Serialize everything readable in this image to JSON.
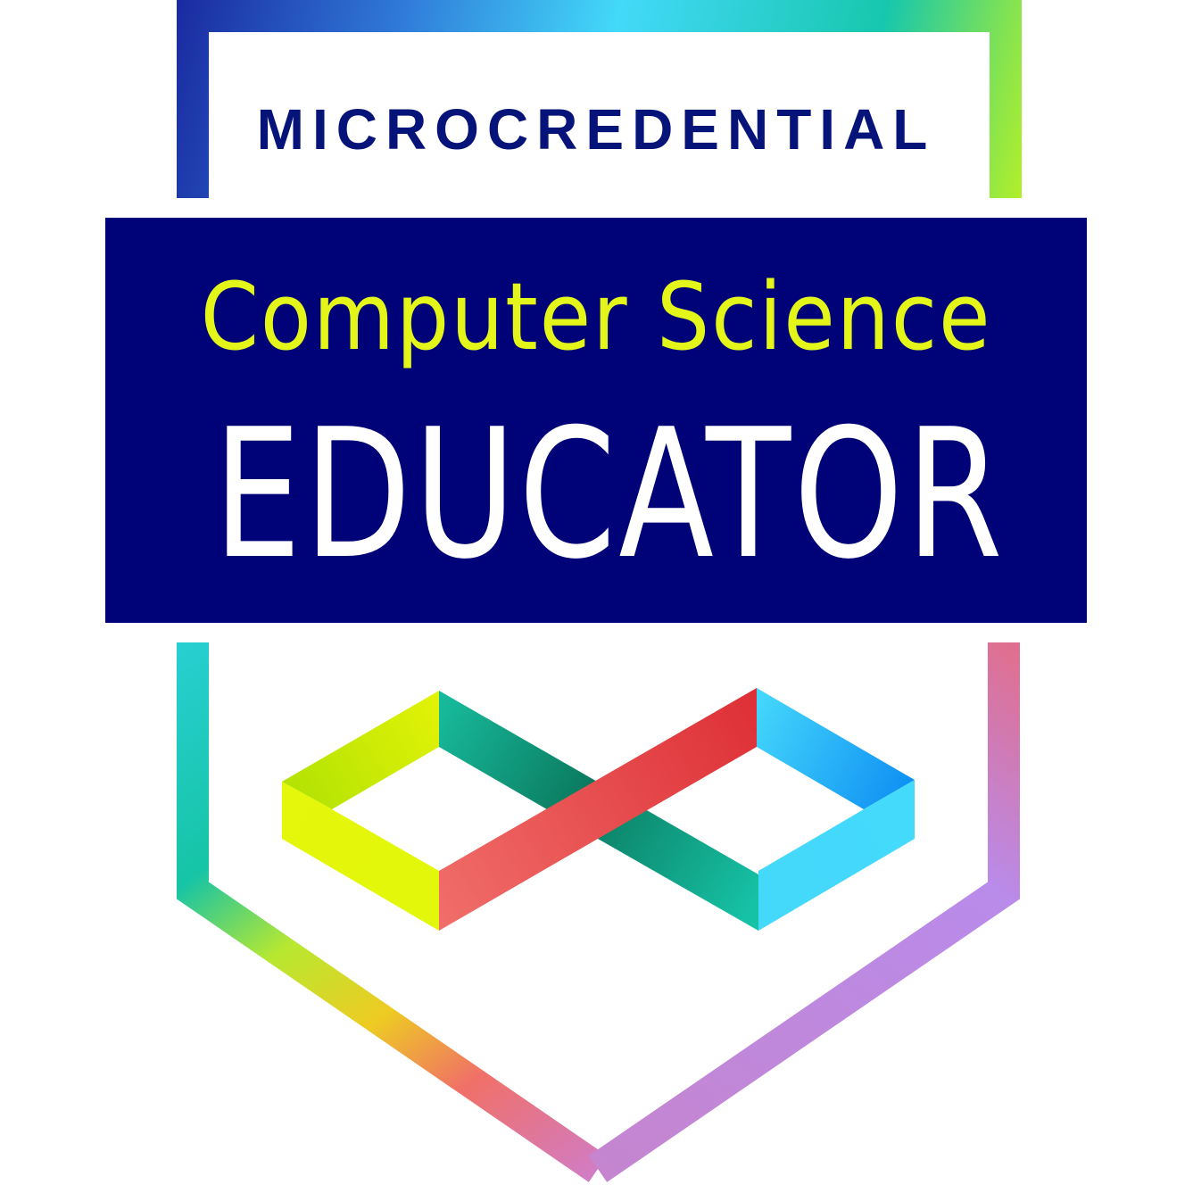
{
  "badge": {
    "kicker": "MICROCREDENTIAL",
    "title_line1": "Computer Science",
    "title_line2": "EDUCATOR",
    "emblem": "infinity-icon"
  },
  "colors": {
    "banner": "#000277",
    "kicker_text": "#06147a",
    "title_line1_text": "#e4f51a",
    "title_line2_text": "#ffffff"
  }
}
